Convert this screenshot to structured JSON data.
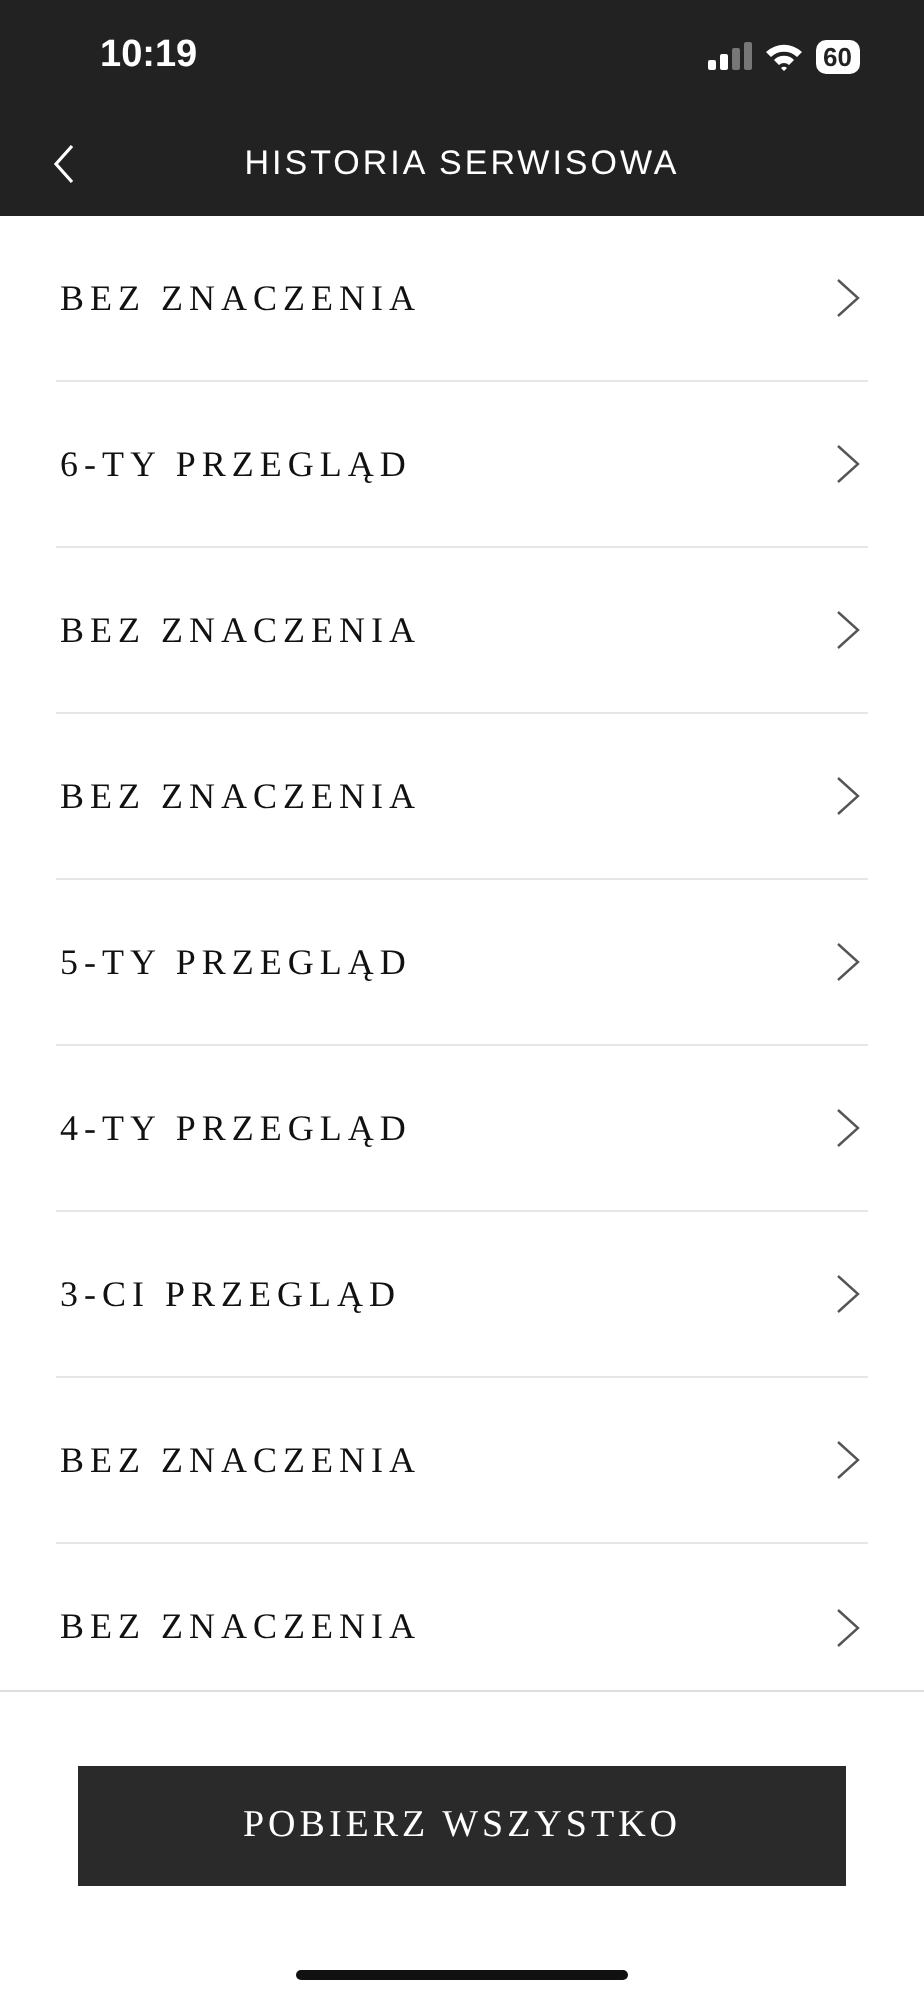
{
  "status_bar": {
    "time": "10:19",
    "battery": "60"
  },
  "nav": {
    "title": "HISTORIA SERWISOWA"
  },
  "items": [
    {
      "label": "BEZ ZNACZENIA"
    },
    {
      "label": "6-TY PRZEGLĄD"
    },
    {
      "label": "BEZ ZNACZENIA"
    },
    {
      "label": "BEZ ZNACZENIA"
    },
    {
      "label": "5-TY PRZEGLĄD"
    },
    {
      "label": "4-TY PRZEGLĄD"
    },
    {
      "label": "3-CI PRZEGLĄD"
    },
    {
      "label": "BEZ ZNACZENIA"
    },
    {
      "label": "BEZ ZNACZENIA"
    }
  ],
  "button": {
    "label": "POBIERZ WSZYSTKO"
  }
}
